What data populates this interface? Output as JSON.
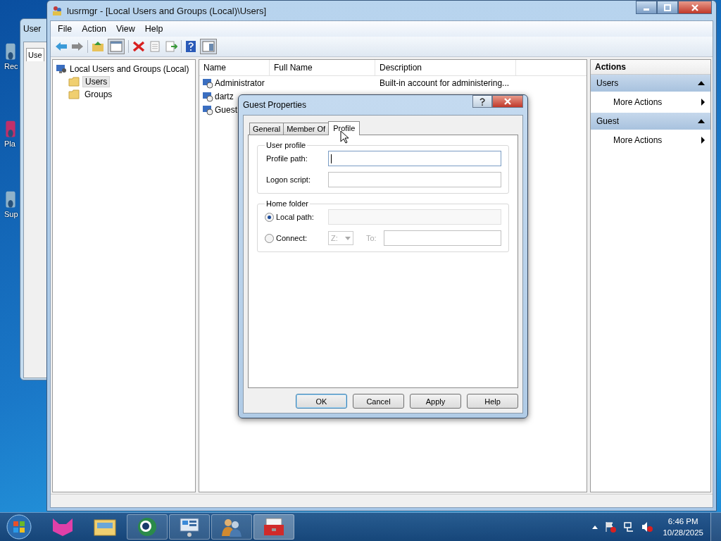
{
  "desktop_icons": [
    {
      "label": "Rec"
    },
    {
      "label": "Pla"
    },
    {
      "label": "Sup"
    }
  ],
  "background_window": {
    "title": "User",
    "tab": "Use"
  },
  "window": {
    "title": "lusrmgr - [Local Users and Groups (Local)\\Users]"
  },
  "menu": [
    "File",
    "Action",
    "View",
    "Help"
  ],
  "tree": {
    "label": "Local Users and Groups (Local)",
    "children": [
      {
        "label": "Users",
        "selected": true
      },
      {
        "label": "Groups",
        "selected": false
      }
    ]
  },
  "list": {
    "columns": [
      "Name",
      "Full Name",
      "Description"
    ],
    "rows": [
      {
        "name": "Administrator",
        "description": "Built-in account for administering..."
      },
      {
        "name": "dartz"
      },
      {
        "name": "Guest"
      }
    ]
  },
  "actions": {
    "title": "Actions",
    "sections": [
      {
        "label": "Users",
        "items": [
          "More Actions"
        ]
      },
      {
        "label": "Guest",
        "items": [
          "More Actions"
        ]
      }
    ]
  },
  "dialog": {
    "title": "Guest Properties",
    "tabs": [
      {
        "label": "General",
        "selected": false
      },
      {
        "label": "Member Of",
        "selected": false
      },
      {
        "label": "Profile",
        "selected": true
      }
    ],
    "user_profile": {
      "label": "User profile",
      "fields": [
        {
          "label": "Profile path:",
          "focused": true
        },
        {
          "label": "Logon script:",
          "focused": false
        }
      ]
    },
    "home_folder": {
      "label": "Home folder",
      "local_path": {
        "label": "Local path:",
        "selected": true
      },
      "connect": {
        "label": "Connect:",
        "selected": false
      },
      "drive": "Z:",
      "to_label": "To:"
    },
    "buttons": [
      {
        "label": "OK",
        "default": true
      },
      {
        "label": "Cancel",
        "default": false
      },
      {
        "label": "Apply",
        "default": false
      },
      {
        "label": "Help",
        "default": false
      }
    ]
  },
  "taskbar": {
    "time": "6:46 PM",
    "date": "10/28/2025"
  }
}
